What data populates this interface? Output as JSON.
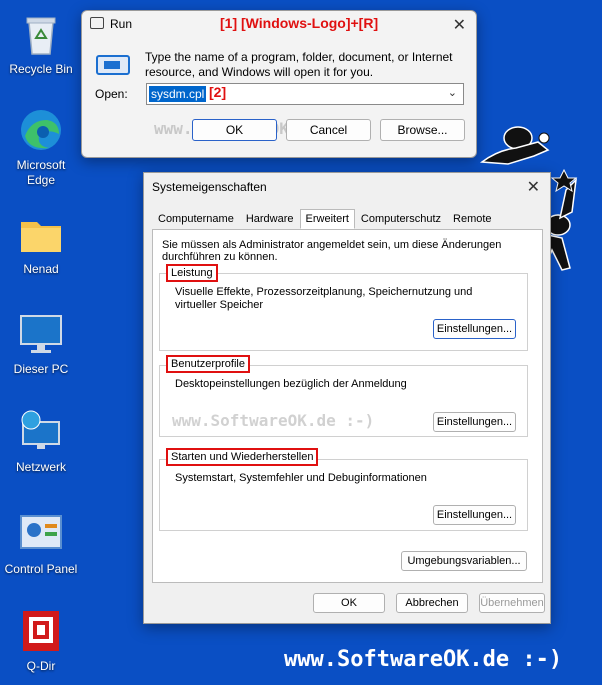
{
  "desktop": {
    "icons": [
      {
        "label": "Recycle Bin",
        "icon": "recycle-bin-icon"
      },
      {
        "label": "Microsoft Edge",
        "icon": "edge-icon"
      },
      {
        "label": "Nenad",
        "icon": "folder-icon"
      },
      {
        "label": "Dieser PC",
        "icon": "monitor-icon"
      },
      {
        "label": "Netzwerk",
        "icon": "network-icon"
      },
      {
        "label": "Control Panel",
        "icon": "control-panel-icon"
      },
      {
        "label": "Q-Dir",
        "icon": "q-dir-icon"
      }
    ],
    "watermark": "www.SoftwareOK.de :-)"
  },
  "run_dialog": {
    "title": "Run",
    "annotation1": "[1]  [Windows-Logo]+[R]",
    "description": "Type the name of a program, folder, document, or Internet resource, and Windows will open it for you.",
    "open_label": "Open:",
    "open_value": "sysdm.cpl",
    "annotation2": "[2]",
    "watermark": "www.SoftwareOK.de :-)",
    "ok_label": "OK",
    "cancel_label": "Cancel",
    "browse_label": "Browse..."
  },
  "sys_dialog": {
    "title": "Systemeigenschaften",
    "tabs": [
      "Computername",
      "Hardware",
      "Erweitert",
      "Computerschutz",
      "Remote"
    ],
    "active_tab": "Erweitert",
    "admin_note": "Sie müssen als Administrator angemeldet sein, um diese Änderungen durchführen zu können.",
    "groups": [
      {
        "label": "Leistung",
        "text": "Visuelle Effekte, Prozessorzeitplanung, Speichernutzung und virtueller Speicher",
        "button": "Einstellungen..."
      },
      {
        "label": "Benutzerprofile",
        "text": "Desktopeinstellungen bezüglich der Anmeldung",
        "button": "Einstellungen..."
      },
      {
        "label": "Starten und Wiederherstellen",
        "text": "Systemstart, Systemfehler und Debuginformationen",
        "button": "Einstellungen..."
      }
    ],
    "env_button": "Umgebungsvariablen...",
    "watermark": "www.SoftwareOK.de :-)",
    "ok_label": "OK",
    "cancel_label": "Abbrechen",
    "apply_label": "Übernehmen"
  }
}
